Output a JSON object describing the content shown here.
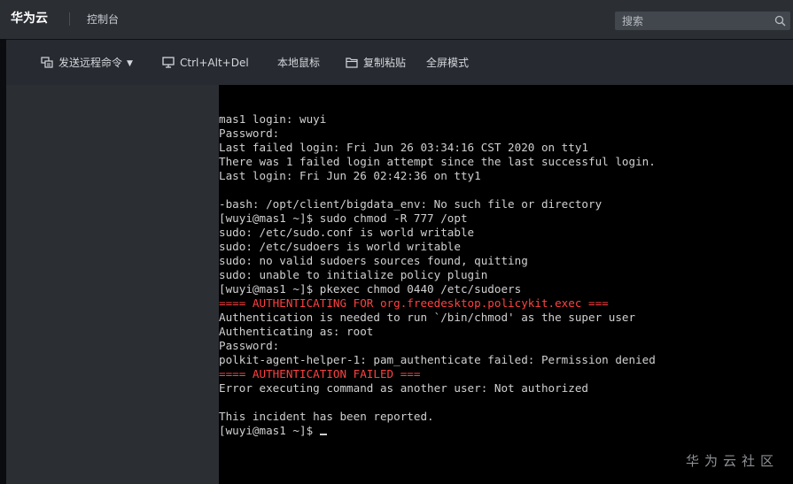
{
  "header": {
    "brand": "华为云",
    "console": "控制台",
    "search_placeholder": "搜索"
  },
  "toolbar": {
    "send_remote": "发送远程命令",
    "ctrl_alt_del": "Ctrl+Alt+Del",
    "local_mouse": "本地鼠标",
    "copy_paste": "复制粘贴",
    "fullscreen": "全屏模式"
  },
  "terminal": {
    "lines": [
      {
        "text": "mas1 login: wuyi",
        "color": "#d0d0d0"
      },
      {
        "text": "Password:",
        "color": "#d0d0d0"
      },
      {
        "text": "Last failed login: Fri Jun 26 03:34:16 CST 2020 on tty1",
        "color": "#d0d0d0"
      },
      {
        "text": "There was 1 failed login attempt since the last successful login.",
        "color": "#d0d0d0"
      },
      {
        "text": "Last login: Fri Jun 26 02:42:36 on tty1",
        "color": "#d0d0d0"
      },
      {
        "text": "",
        "color": "#d0d0d0"
      },
      {
        "text": "-bash: /opt/client/bigdata_env: No such file or directory",
        "color": "#d0d0d0"
      },
      {
        "text": "[wuyi@mas1 ~]$ sudo chmod -R 777 /opt",
        "color": "#d0d0d0"
      },
      {
        "text": "sudo: /etc/sudo.conf is world writable",
        "color": "#d0d0d0"
      },
      {
        "text": "sudo: /etc/sudoers is world writable",
        "color": "#d0d0d0"
      },
      {
        "text": "sudo: no valid sudoers sources found, quitting",
        "color": "#d0d0d0"
      },
      {
        "text": "sudo: unable to initialize policy plugin",
        "color": "#d0d0d0"
      },
      {
        "text": "[wuyi@mas1 ~]$ pkexec chmod 0440 /etc/sudoers",
        "color": "#d0d0d0"
      },
      {
        "text": "==== AUTHENTICATING FOR org.freedesktop.policykit.exec ===",
        "color": "#ff4141"
      },
      {
        "text": "Authentication is needed to run `/bin/chmod' as the super user",
        "color": "#d0d0d0"
      },
      {
        "text": "Authenticating as: root",
        "color": "#d0d0d0"
      },
      {
        "text": "Password:",
        "color": "#d0d0d0"
      },
      {
        "text": "polkit-agent-helper-1: pam_authenticate failed: Permission denied",
        "color": "#d0d0d0"
      },
      {
        "text": "==== AUTHENTICATION FAILED ===",
        "color": "#ff4141"
      },
      {
        "text": "Error executing command as another user: Not authorized",
        "color": "#d0d0d0"
      },
      {
        "text": "",
        "color": "#d0d0d0"
      },
      {
        "text": "This incident has been reported.",
        "color": "#d0d0d0"
      }
    ],
    "prompt": "[wuyi@mas1 ~]$ "
  },
  "watermark": "华为云社区",
  "colors": {
    "topbar_bg": "#2b2e33",
    "toolbar_bg": "#272a30",
    "terminal_bg": "#000000",
    "terminal_text": "#d0d0d0",
    "terminal_error": "#ff4141"
  }
}
